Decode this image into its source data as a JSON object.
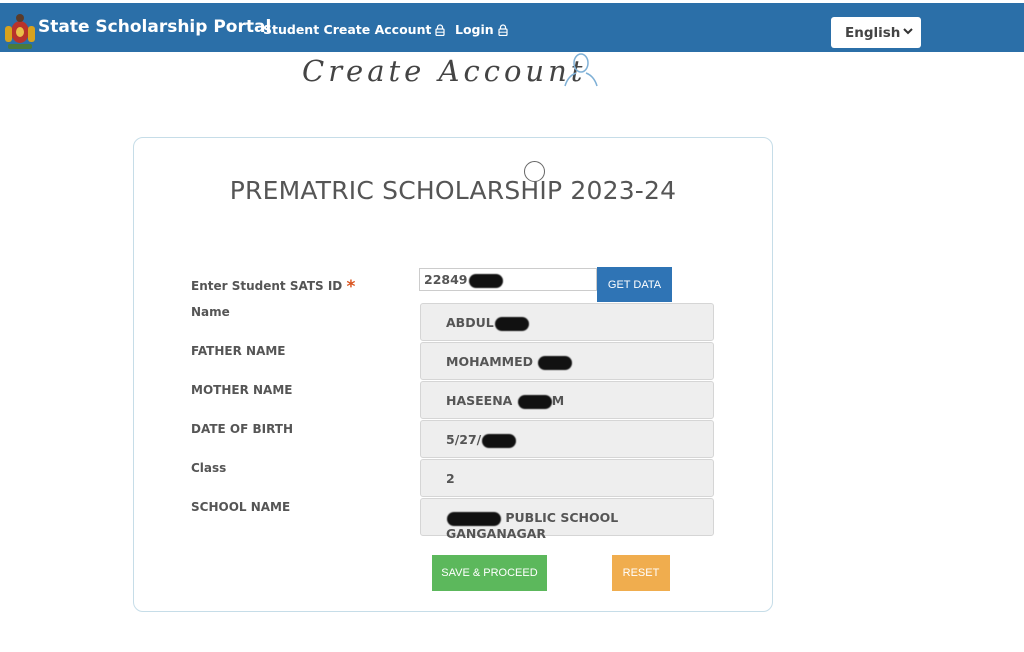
{
  "header": {
    "brand": "State Scholarship Portal",
    "nav": [
      {
        "label": "Student Create Account",
        "icon": "lock-icon"
      },
      {
        "label": "Login",
        "icon": "lock-icon"
      }
    ],
    "language": {
      "selected": "English"
    },
    "colors": {
      "bar": "#2b6fa8"
    }
  },
  "page": {
    "title": "Create Account",
    "icon": "user-outline-icon"
  },
  "form": {
    "title": "PREMATRIC SCHOLARSHIP 2023-24",
    "sats": {
      "label": "Enter Student SATS ID",
      "required_mark": "*",
      "value": "22849",
      "button": "GET DATA"
    },
    "fields": [
      {
        "label": "Name",
        "value": "ABDUL",
        "redacted_after": true
      },
      {
        "label": "FATHER NAME",
        "value": "MOHAMMED ",
        "redacted_after": true
      },
      {
        "label": "MOTHER NAME",
        "value": "HASEENA ",
        "redacted_after": true,
        "suffix": "M"
      },
      {
        "label": "DATE OF BIRTH",
        "value": "5/27/",
        "redacted_after": true
      },
      {
        "label": "Class",
        "value": "2"
      },
      {
        "label": "SCHOOL NAME",
        "value": " PUBLIC SCHOOL GANGANAGAR",
        "redacted_before": true
      }
    ],
    "buttons": {
      "save": "SAVE & PROCEED",
      "reset": "RESET"
    },
    "colors": {
      "save": "#5cb85c",
      "reset": "#f0ad4e",
      "get_data": "#2f74b5"
    }
  }
}
